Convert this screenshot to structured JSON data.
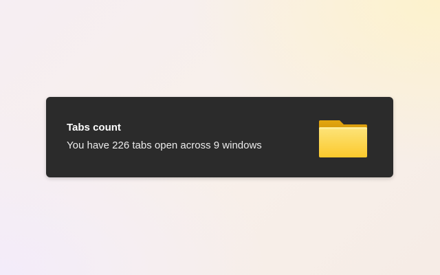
{
  "notification": {
    "title": "Tabs count",
    "message": "You have 226 tabs open across 9 windows",
    "icon": "folder-icon",
    "colors": {
      "background": "#2b2b2b",
      "title": "#ffffff",
      "message": "#ececec",
      "folder_front": "#fcd34d",
      "folder_back": "#d99a08"
    }
  }
}
